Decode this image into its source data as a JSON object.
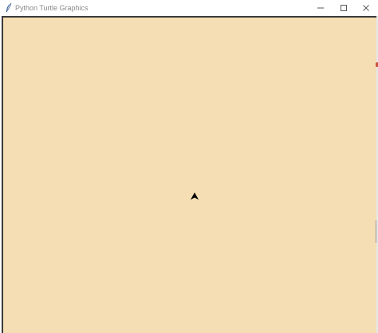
{
  "window": {
    "title": "Python Turtle Graphics",
    "icon": "feather-icon",
    "controls": {
      "minimize_icon": "minimize-icon",
      "maximize_icon": "maximize-icon",
      "close_icon": "close-icon"
    }
  },
  "canvas": {
    "background_color": "#f5deb3",
    "turtle_shape": "classic-arrow",
    "turtle_color": "#000000",
    "turtle_heading": "up"
  }
}
